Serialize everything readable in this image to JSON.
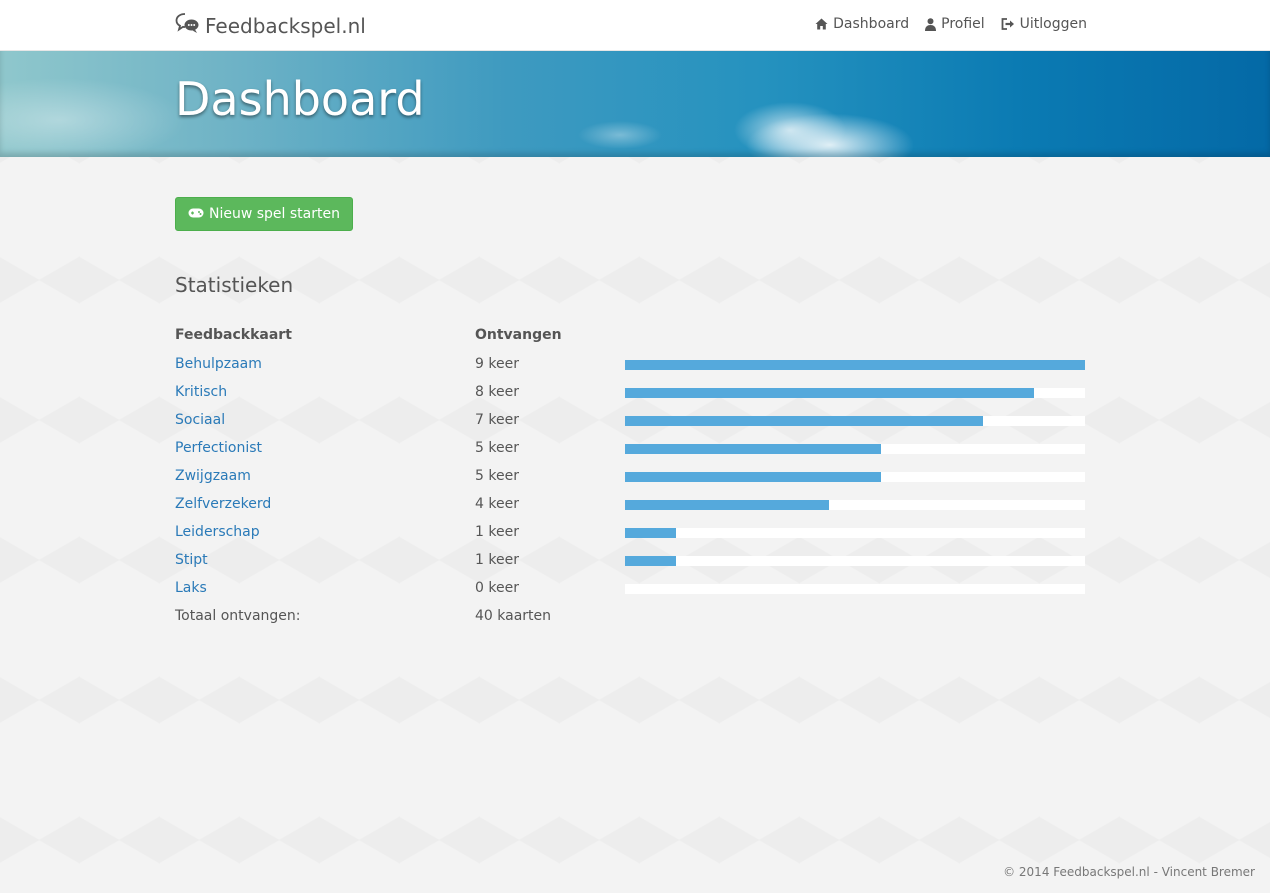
{
  "brand": {
    "name": "Feedbackspel.nl",
    "icon": "chat-bubbles-icon"
  },
  "nav": [
    {
      "label": "Dashboard",
      "icon": "home-icon"
    },
    {
      "label": "Profiel",
      "icon": "user-icon"
    },
    {
      "label": "Uitloggen",
      "icon": "sign-out-icon"
    }
  ],
  "hero": {
    "title": "Dashboard"
  },
  "actions": {
    "new_game_label": "Nieuw spel starten",
    "new_game_icon": "gamepad-icon"
  },
  "stats": {
    "title": "Statistieken",
    "columns": {
      "card": "Feedbackkaart",
      "received": "Ontvangen"
    },
    "rows": [
      {
        "name": "Behulpzaam",
        "count": "9 keer",
        "fraction": 1.0
      },
      {
        "name": "Kritisch",
        "count": "8 keer",
        "fraction": 0.889
      },
      {
        "name": "Sociaal",
        "count": "7 keer",
        "fraction": 0.778
      },
      {
        "name": "Perfectionist",
        "count": "5 keer",
        "fraction": 0.556
      },
      {
        "name": "Zwijgzaam",
        "count": "5 keer",
        "fraction": 0.556
      },
      {
        "name": "Zelfverzekerd",
        "count": "4 keer",
        "fraction": 0.444
      },
      {
        "name": "Leiderschap",
        "count": "1 keer",
        "fraction": 0.111
      },
      {
        "name": "Stipt",
        "count": "1 keer",
        "fraction": 0.111
      },
      {
        "name": "Laks",
        "count": "0 keer",
        "fraction": 0.0
      }
    ],
    "total_label": "Totaal ontvangen:",
    "total_value": "40 kaarten"
  },
  "footer": {
    "text": "© 2014 Feedbackspel.nl - Vincent Bremer"
  },
  "colors": {
    "accent": "#55a9dc",
    "link": "#2a7ab8",
    "button": "#5cb85c"
  }
}
